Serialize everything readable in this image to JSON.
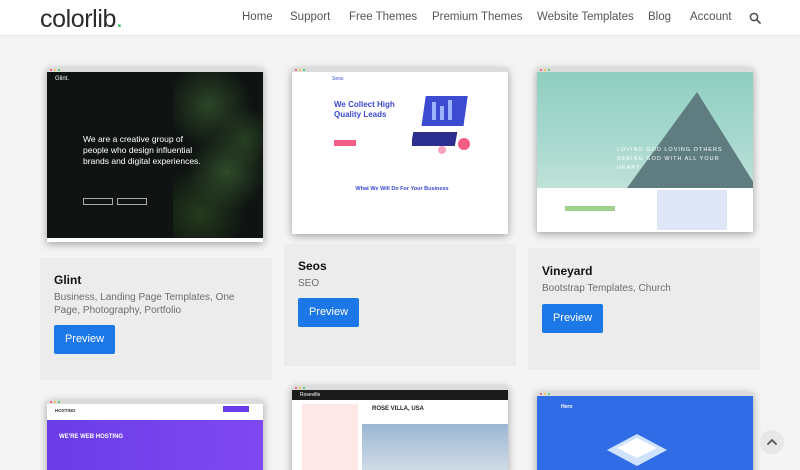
{
  "header": {
    "logo_text": "colorlib",
    "logo_dot": ".",
    "nav": [
      "Home",
      "Support",
      "Free Themes",
      "Premium Themes",
      "Website Templates",
      "Blog",
      "Account"
    ],
    "search_icon": "search-icon"
  },
  "cards": [
    {
      "title": "Glint",
      "tags": "Business, Landing Page Templates, One Page, Photography, Portfolio",
      "button": "Preview",
      "thumb": {
        "headline": "We are a creative group of people who design influential brands and digital experiences.",
        "brand": "Glint."
      }
    },
    {
      "title": "Seos",
      "tags": "SEO",
      "button": "Preview",
      "thumb": {
        "headline": "We Collect High Quality Leads",
        "sub": "What We Will Do For Your Business",
        "brand": "Seos"
      }
    },
    {
      "title": "Vineyard",
      "tags": "Bootstrap Templates, Church",
      "button": "Preview",
      "thumb": {
        "headline": "LOVING GOD LOVING OTHERS SEEING GOD WITH ALL YOUR HEART"
      }
    }
  ],
  "row2": [
    {
      "thumb_text": "WE'RE WEB HOSTING",
      "brand": "HOSTING"
    },
    {
      "thumb_text": "ROSE VILLA, USA",
      "brand": "Roseville"
    },
    {
      "thumb_text": "",
      "brand": "Hero"
    }
  ],
  "colors": {
    "accent": "#1c78e6",
    "logo_dot": "#32c25a"
  },
  "scroll_top_icon": "chevron-up-icon"
}
